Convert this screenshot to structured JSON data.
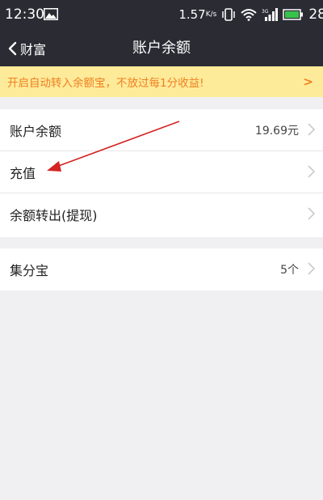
{
  "status_bar": {
    "time": "12:30",
    "speed": "1.57",
    "speed_unit": "K/s",
    "battery": "28",
    "icons": [
      "image-icon",
      "vibrate-icon",
      "wifi-icon",
      "signal-icon",
      "battery-icon"
    ]
  },
  "nav": {
    "back_label": "财富",
    "title": "账户余额"
  },
  "banner": {
    "text": "开启自动转入余额宝，不放过每1分收益!",
    "arrow": ">"
  },
  "list": [
    {
      "label": "账户余额",
      "value": "19.69元"
    },
    {
      "label": "充值",
      "value": ""
    },
    {
      "label": "余额转出(提现)",
      "value": ""
    }
  ],
  "list2": [
    {
      "label": "集分宝",
      "value": "5个"
    }
  ],
  "colors": {
    "header": "#2a2b33",
    "banner_bg": "#fdeb9a",
    "banner_text": "#f07f20",
    "annotation_arrow": "#d42323"
  }
}
